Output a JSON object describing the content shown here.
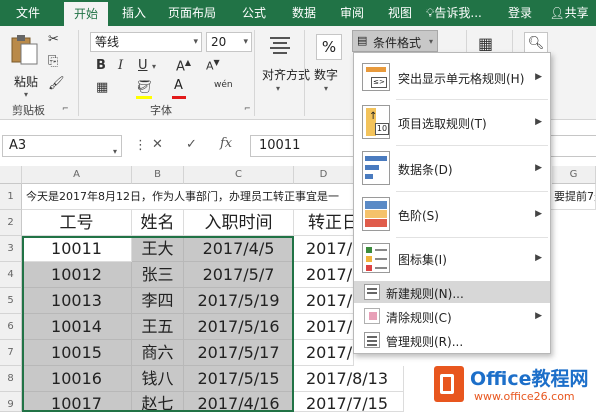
{
  "tabs": [
    "文件",
    "开始",
    "插入",
    "页面布局",
    "公式",
    "数据",
    "审阅",
    "视图",
    "告诉我...",
    "登录",
    "共享"
  ],
  "ribbon": {
    "paste_label": "粘贴",
    "clipboard_label": "剪贴板",
    "font_name": "等线",
    "font_size": "20",
    "font_group_label": "字体",
    "bold": "B",
    "italic": "I",
    "underline": "U",
    "font_color_glyph": "A",
    "font_size_up": "A",
    "font_size_down": "A",
    "wen": "wén",
    "align_label": "对齐方式",
    "number_label": "数字",
    "percent": "%",
    "cond_format_label": "条件格式",
    "group_launcher": "⌐"
  },
  "formula_bar": {
    "name_box": "A3",
    "fx": "fx",
    "formula": "10011"
  },
  "columns": [
    "A",
    "B",
    "C",
    "D",
    "E",
    "F",
    "G",
    "H"
  ],
  "rows": [
    "1",
    "2",
    "3",
    "4",
    "5",
    "6",
    "7",
    "8",
    "9"
  ],
  "row1_text": "今天是2017年8月12日，作为人事部门，办理员工转正事宜是一",
  "row1_tail": "要提前7天",
  "headers": [
    "工号",
    "姓名",
    "入职时间",
    "转正日"
  ],
  "table": [
    [
      "10011",
      "王大",
      "2017/4/5",
      "2017/"
    ],
    [
      "10012",
      "张三",
      "2017/5/7",
      "2017/"
    ],
    [
      "10013",
      "李四",
      "2017/5/19",
      "2017/"
    ],
    [
      "10014",
      "王五",
      "2017/5/16",
      "2017/"
    ],
    [
      "10015",
      "商六",
      "2017/5/17",
      "2017/"
    ],
    [
      "10016",
      "钱八",
      "2017/5/15",
      "2017/8/13"
    ],
    [
      "10017",
      "赵七",
      "2017/4/16",
      "2017/7/15"
    ]
  ],
  "menu": [
    {
      "label": "突出显示单元格规则(H)",
      "icon": "highlight-rules-icon",
      "submenu": true
    },
    {
      "label": "项目选取规则(T)",
      "icon": "top-bottom-rules-icon",
      "submenu": true
    },
    {
      "label": "数据条(D)",
      "icon": "data-bars-icon",
      "submenu": true
    },
    {
      "label": "色阶(S)",
      "icon": "color-scales-icon",
      "submenu": true
    },
    {
      "label": "图标集(I)",
      "icon": "icon-sets-icon",
      "submenu": true
    },
    {
      "label": "新建规则(N)...",
      "icon": "new-rule-icon",
      "submenu": false,
      "highlighted": true
    },
    {
      "label": "清除规则(C)",
      "icon": "clear-rules-icon",
      "submenu": true
    },
    {
      "label": "管理规则(R)...",
      "icon": "manage-rules-icon",
      "submenu": false
    }
  ],
  "menu_icon_texts": [
    "≤>",
    "10"
  ],
  "watermark": {
    "brand": "Office教程网",
    "url": "www.office26.com"
  },
  "colors": {
    "ribbon_green": "#217346",
    "selection_gray": "#c8c8c8",
    "menu_highlight": "#d7d7d7",
    "watermark_orange": "#e8561e",
    "watermark_blue": "#1d6fc9"
  }
}
